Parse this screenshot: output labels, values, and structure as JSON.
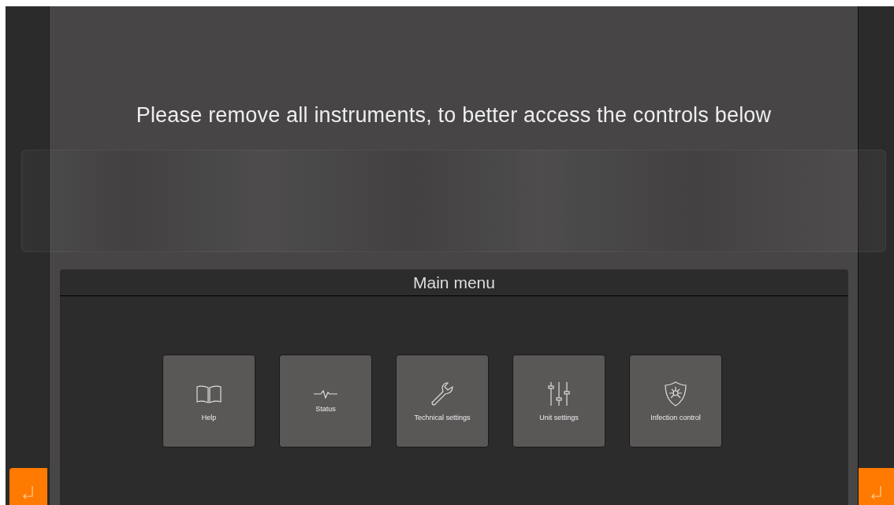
{
  "notice": "Please remove all instruments, to better access the controls below",
  "menu": {
    "title": "Main menu",
    "items": [
      {
        "label": "Help",
        "kind": "book"
      },
      {
        "label": "Status",
        "kind": "pulse"
      },
      {
        "label": "Technical settings",
        "kind": "wrench"
      },
      {
        "label": "Unit settings",
        "kind": "sliders"
      },
      {
        "label": "Infection control",
        "kind": "shield"
      }
    ]
  }
}
